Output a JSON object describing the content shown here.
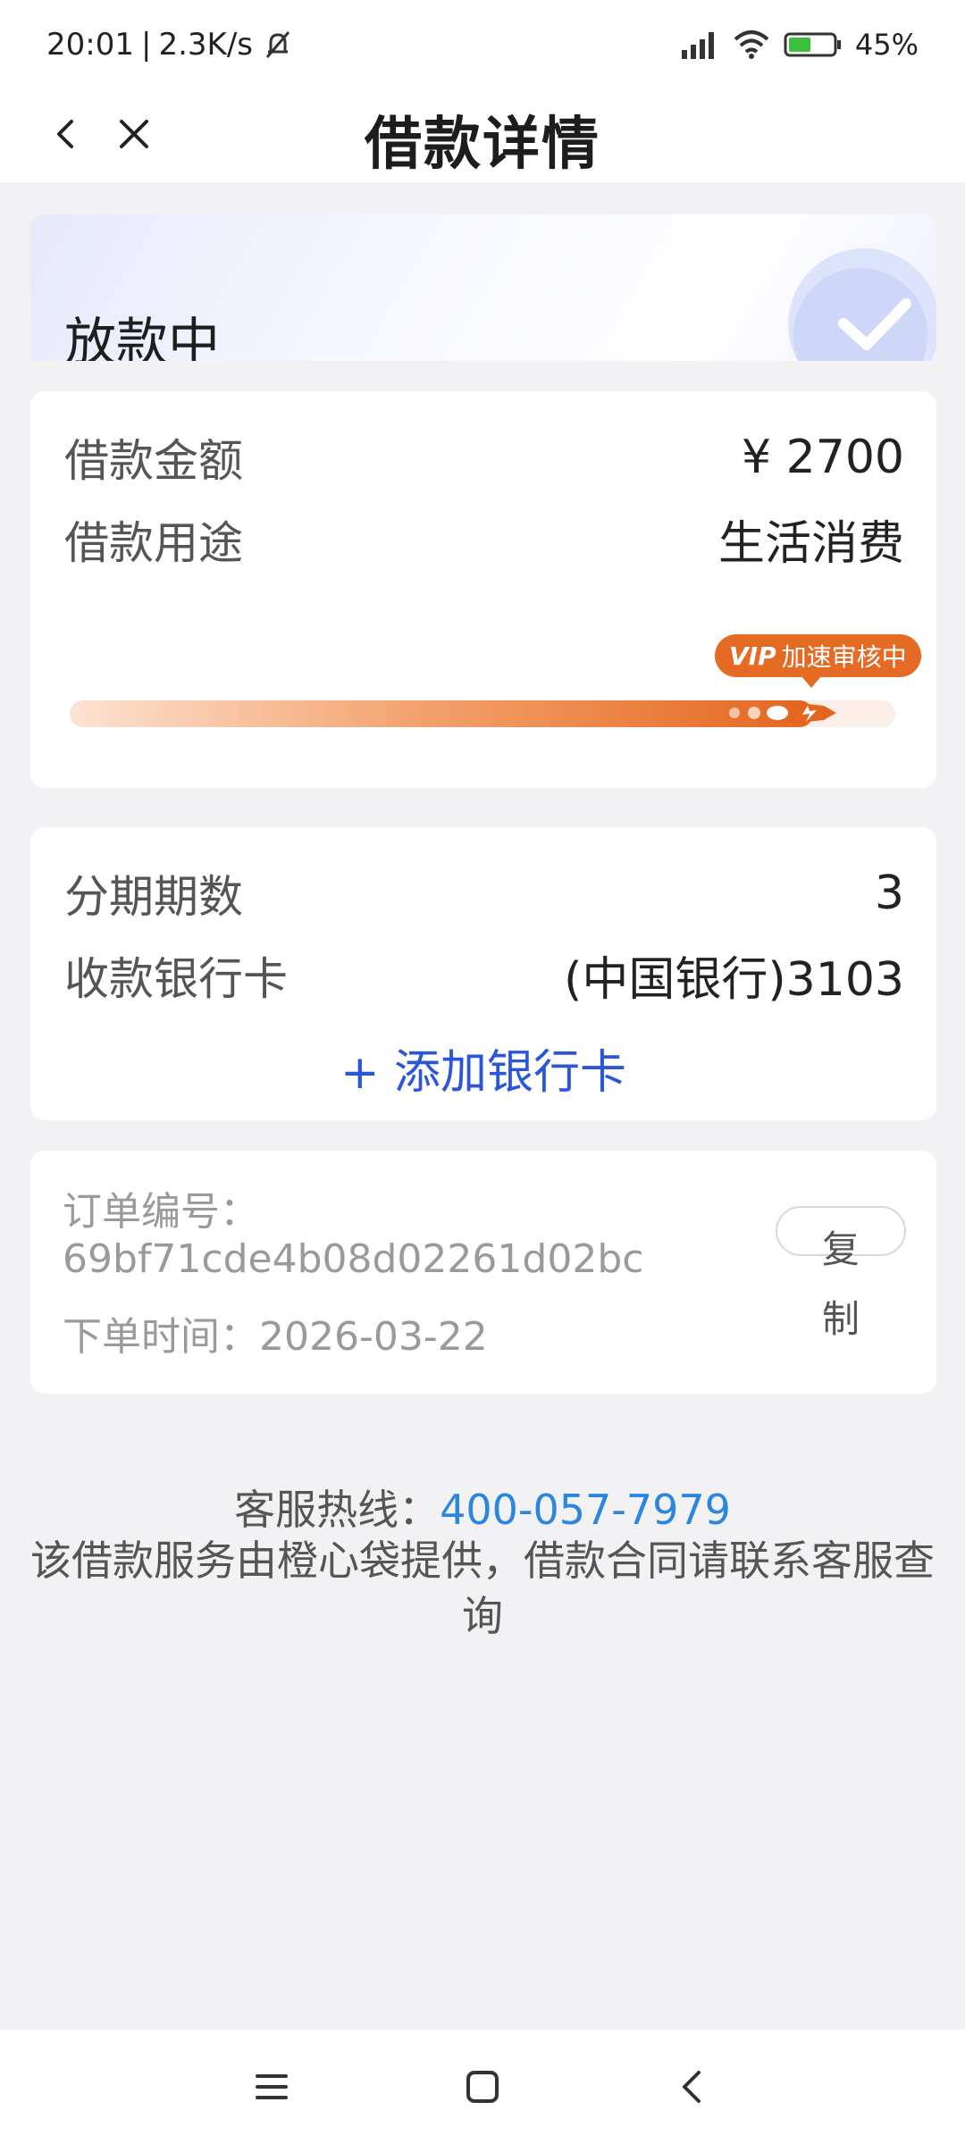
{
  "status_bar": {
    "time": "20:01",
    "separator": "|",
    "net_speed": "2.3K/s",
    "battery": "45%"
  },
  "header": {
    "title": "借款详情"
  },
  "status_card": {
    "status": "放款中"
  },
  "amount_card": {
    "amount_label": "借款金额",
    "amount_value": "¥ 2700",
    "purpose_label": "借款用途",
    "purpose_value": "生活消费",
    "vip_tag": "VIP",
    "vip_text": "加速审核中",
    "progress": 0.9
  },
  "bank_card": {
    "installments_label": "分期期数",
    "installments_value": "3",
    "bank_label": "收款银行卡",
    "bank_value": "(中国银行)3103",
    "add_card_label": "+ 添加银行卡"
  },
  "order_card": {
    "order_no_label": "订单编号：",
    "order_no": "69bf71cde4b08d02261d02bc",
    "order_time_label": "下单时间：",
    "order_time": "2026-03-22",
    "copy_label": "复制"
  },
  "footer": {
    "hotline_label": "客服热线：",
    "hotline_number": "400-057-7979",
    "note": "该借款服务由橙心袋提供，借款合同请联系客服查询"
  },
  "colors": {
    "accent_blue": "#2b56d9",
    "hotline_blue": "#2b86e0",
    "vip_orange": "#e56a24"
  },
  "icons": {
    "back": "chevron-left-icon",
    "close": "close-icon",
    "menu": "menu-icon",
    "home": "home-icon",
    "sys_back": "back-icon"
  }
}
